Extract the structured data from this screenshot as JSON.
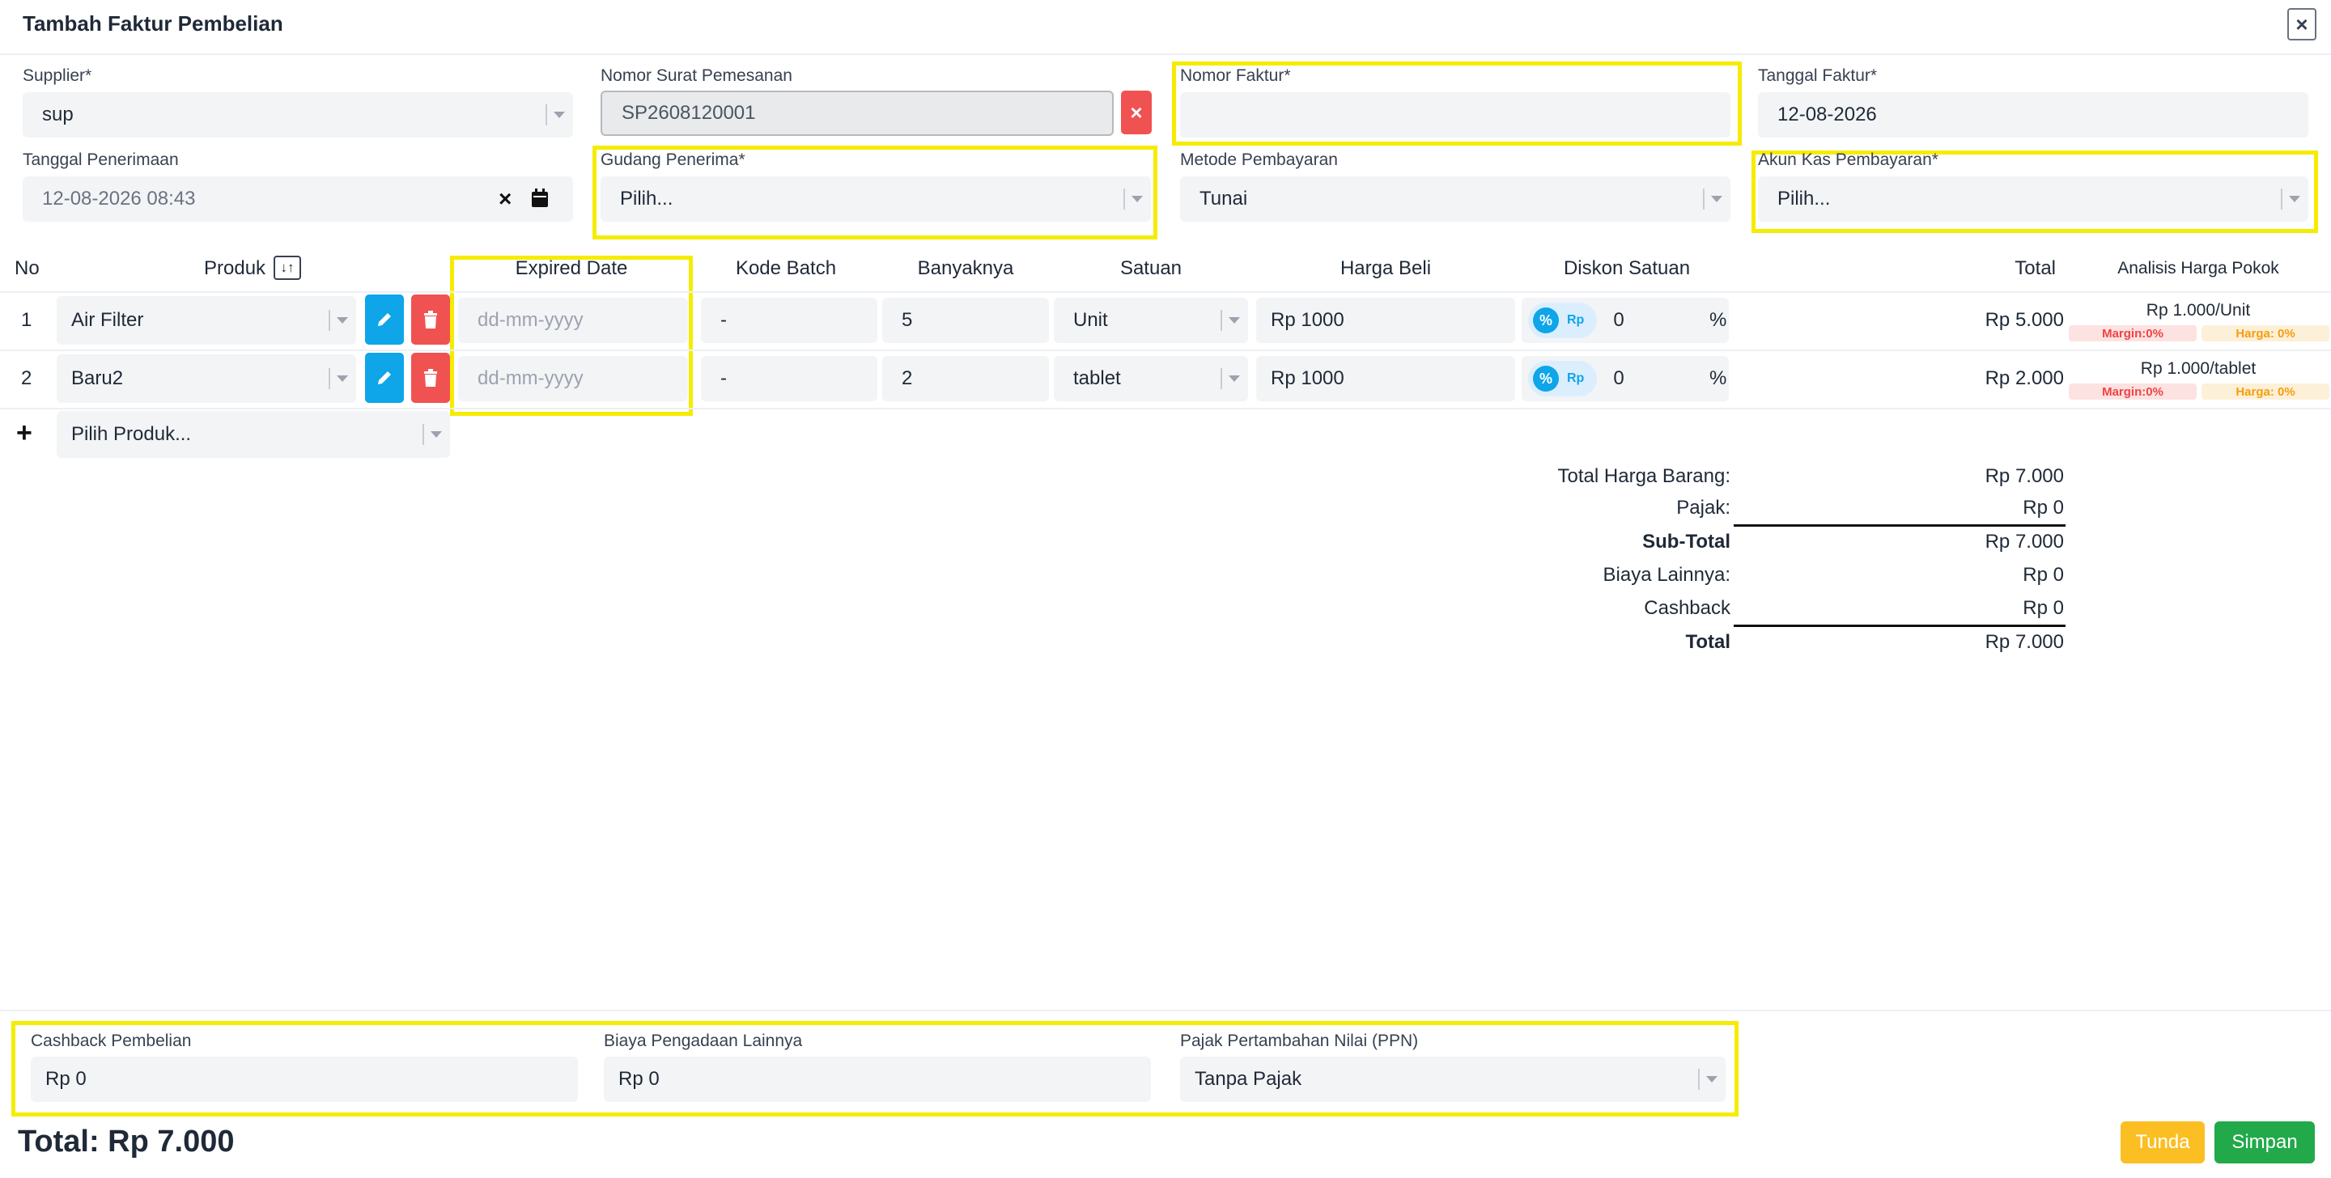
{
  "modal": {
    "title": "Tambah Faktur Pembelian"
  },
  "form": {
    "supplier": {
      "label": "Supplier*",
      "value": "sup"
    },
    "order_no": {
      "label": "Nomor Surat Pemesanan",
      "value": "SP2608120001"
    },
    "invoice_no": {
      "label": "Nomor Faktur*",
      "value": ""
    },
    "invoice_date": {
      "label": "Tanggal Faktur*",
      "value": "12-08-2026"
    },
    "receive_date": {
      "label": "Tanggal Penerimaan",
      "value": "12-08-2026 08:43"
    },
    "warehouse": {
      "label": "Gudang Penerima*",
      "placeholder": "Pilih..."
    },
    "payment_method": {
      "label": "Metode Pembayaran",
      "value": "Tunai"
    },
    "cash_account": {
      "label": "Akun Kas Pembayaran*",
      "placeholder": "Pilih..."
    }
  },
  "table": {
    "headers": {
      "no": "No",
      "product": "Produk",
      "expired": "Expired Date",
      "batch": "Kode Batch",
      "qty": "Banyaknya",
      "unit": "Satuan",
      "price": "Harga Beli",
      "discount": "Diskon Satuan",
      "total": "Total",
      "analysis": "Analisis Harga Pokok"
    },
    "rows": [
      {
        "no": "1",
        "product": "Air Filter",
        "expired_placeholder": "dd-mm-yyyy",
        "batch": "-",
        "qty": "5",
        "unit": "Unit",
        "price": "Rp 1000",
        "disc_toggle_on": "%",
        "disc_toggle_off": "Rp",
        "discount": "0",
        "disc_unit": "%",
        "total": "Rp 5.000",
        "hpp": "Rp 1.000/Unit",
        "margin": "Margin:0%",
        "harga": "Harga: 0%"
      },
      {
        "no": "2",
        "product": "Baru2",
        "expired_placeholder": "dd-mm-yyyy",
        "batch": "-",
        "qty": "2",
        "unit": "tablet",
        "price": "Rp 1000",
        "disc_toggle_on": "%",
        "disc_toggle_off": "Rp",
        "discount": "0",
        "disc_unit": "%",
        "total": "Rp 2.000",
        "hpp": "Rp 1.000/tablet",
        "margin": "Margin:0%",
        "harga": "Harga: 0%"
      }
    ],
    "add_product": {
      "icon": "+",
      "placeholder": "Pilih Produk..."
    }
  },
  "summary": [
    {
      "label": "Total Harga Barang:",
      "value": "Rp 7.000"
    },
    {
      "label": "Pajak:",
      "value": "Rp 0"
    },
    {
      "label": "Sub-Total",
      "value": "Rp 7.000"
    },
    {
      "label": "Biaya Lainnya:",
      "value": "Rp 0"
    },
    {
      "label": "Cashback",
      "value": "Rp 0"
    },
    {
      "label": "Total",
      "value": "Rp 7.000"
    }
  ],
  "footer": {
    "cashback": {
      "label": "Cashback Pembelian",
      "value": "Rp 0"
    },
    "other_cost": {
      "label": "Biaya Pengadaan Lainnya",
      "value": "Rp 0"
    },
    "ppn": {
      "label": "Pajak Pertambahan Nilai (PPN)",
      "value": "Tanpa Pajak"
    },
    "grand_total": "Total: Rp 7.000",
    "pending_label": "Tunda",
    "save_label": "Simpan"
  },
  "colors": {
    "accent_blue": "#0ea5e9",
    "danger": "#f05252",
    "warning": "#fbbf24",
    "success": "#22a94a",
    "highlight": "#f5ec00"
  },
  "icons": [
    "close-icon",
    "clear-icon",
    "calendar-icon",
    "sort-icon",
    "edit-icon",
    "trash-icon",
    "plus-icon",
    "chevron-down-icon"
  ]
}
